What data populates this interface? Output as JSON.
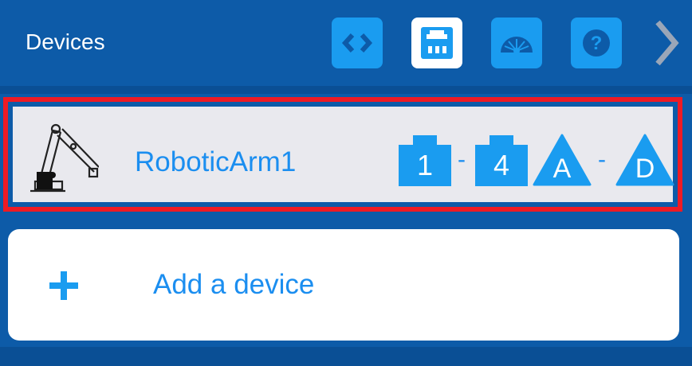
{
  "header": {
    "title": "Devices",
    "buttons": [
      {
        "icon": "code-brackets-icon",
        "active": false
      },
      {
        "icon": "ports-icon",
        "active": true
      },
      {
        "icon": "dashboard-gauge-icon",
        "active": false
      },
      {
        "icon": "help-icon",
        "active": false
      }
    ],
    "next_icon": "chevron-right-icon"
  },
  "device": {
    "name": "RoboticArm1",
    "icon": "robotic-arm-icon",
    "ports": [
      {
        "label": "1",
        "shape": "smart-port"
      },
      {
        "separator": "-"
      },
      {
        "label": "4",
        "shape": "smart-port"
      },
      {
        "label": "A",
        "shape": "three-wire-port"
      },
      {
        "separator": "-"
      },
      {
        "label": "D",
        "shape": "three-wire-port"
      }
    ],
    "selected": true
  },
  "add_device": {
    "label": "Add a device",
    "icon": "plus-icon"
  },
  "colors": {
    "background": "#0d5ba8",
    "accent": "#1a9cf0",
    "text_blue": "#1b8ef0",
    "selection_border": "#ee1b24",
    "card_gray": "#e9e9ee"
  }
}
